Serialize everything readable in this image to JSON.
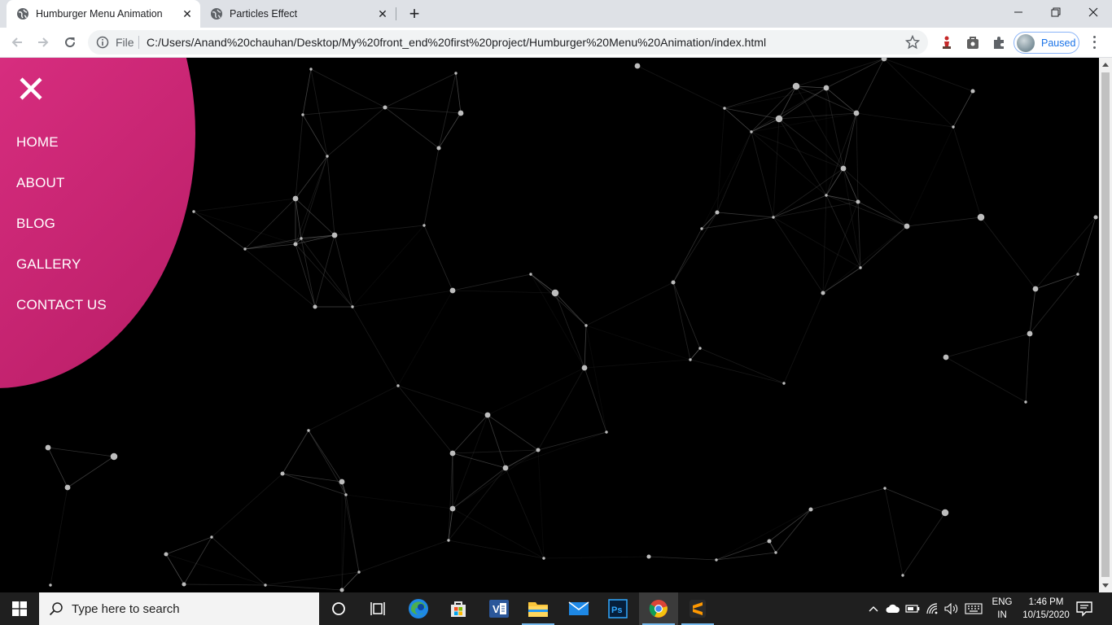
{
  "browser": {
    "tabs": [
      {
        "title": "Humburger Menu Animation",
        "active": true
      },
      {
        "title": "Particles Effect",
        "active": false
      }
    ],
    "url_scheme_label": "File",
    "url": "C:/Users/Anand%20chauhan/Desktop/My%20front_end%20first%20project/Humburger%20Menu%20Animation/index.html",
    "profile_label": "Paused"
  },
  "page": {
    "menu": {
      "items": [
        "HOME",
        "ABOUT",
        "BLOG",
        "GALLERY",
        "CONTACT US"
      ]
    },
    "colors": {
      "background": "#000000",
      "menu_gradient_start": "#f04b9a",
      "menu_gradient_end": "#b81d66",
      "particle": "#bdbdbd",
      "link_line": "#8a8a8a"
    }
  },
  "taskbar": {
    "search_placeholder": "Type here to search",
    "apps": [
      "cortana-icon",
      "task-view-icon",
      "edge-icon",
      "store-icon",
      "visual-studio-icon",
      "file-explorer-icon",
      "mail-icon",
      "photoshop-icon",
      "chrome-icon",
      "sublime-text-icon"
    ],
    "language_line1": "ENG",
    "language_line2": "IN",
    "time": "1:46 PM",
    "date": "10/15/2020"
  }
}
